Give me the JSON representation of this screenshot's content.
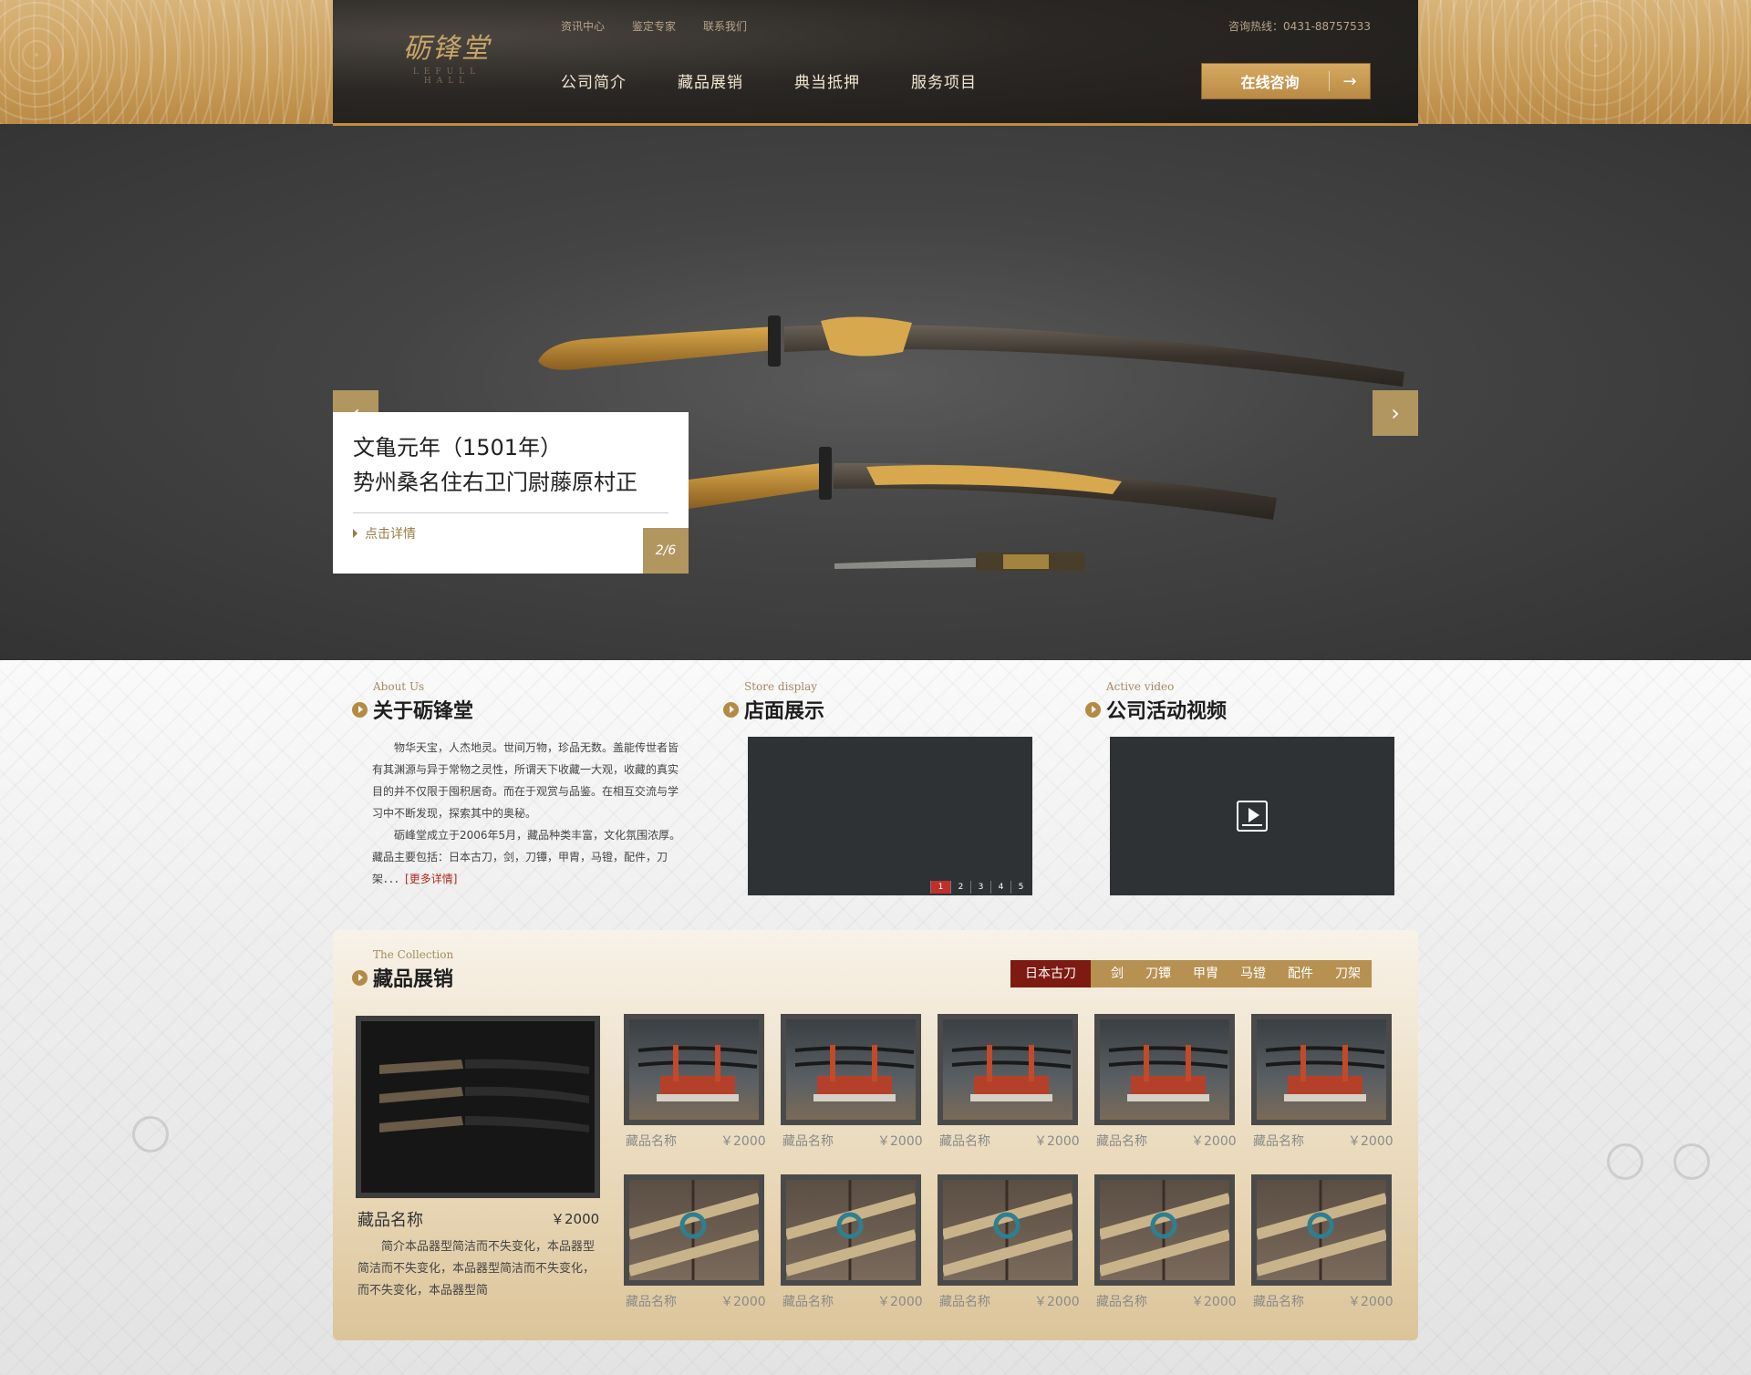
{
  "header": {
    "logo_cn": "砺锋堂",
    "logo_en": "LEFULL HALL",
    "top_links": [
      "资讯中心",
      "鉴定专家",
      "联系我们"
    ],
    "hotline": "咨询热线：0431-88757533",
    "nav": [
      "公司简介",
      "藏品展销",
      "典当抵押",
      "服务项目"
    ],
    "consult_label": "在线咨询",
    "consult_arrow": "→"
  },
  "hero": {
    "caption_line1": "文亀元年（1501年）",
    "caption_line2": "势州桑名住右卫门尉藤原村正",
    "more_label": "点击详情",
    "page_indicator": "2/6",
    "prev_icon": "‹",
    "next_icon": "›"
  },
  "about": {
    "en": "About Us",
    "title": "关于砺锋堂",
    "para1": "物华天宝，人杰地灵。世间万物，珍品无数。盖能传世者皆有其渊源与异于常物之灵性，所谓天下收藏一大观，收藏的真实目的并不仅限于囤积居奇。而在于观赏与品鉴。在相互交流与学习中不断发现，探索其中的奥秘。",
    "para2": "砺峰堂成立于2006年5月，藏品种类丰富，文化氛围浓厚。藏品主要包括：日本古刀，剑，刀镡，甲胄，马镫，配件，刀架．．．",
    "more_label": "[更多详情]"
  },
  "store": {
    "en": "Store display",
    "title": "店面展示",
    "pages": [
      "1",
      "2",
      "3",
      "4",
      "5"
    ],
    "active_page": "1"
  },
  "video": {
    "en": "Active video",
    "title": "公司活动视频"
  },
  "collection": {
    "en": "The Collection",
    "title": "藏品展销",
    "tabs": [
      "日本古刀",
      "剑",
      "刀镡",
      "甲胄",
      "马镫",
      "配件",
      "刀架"
    ],
    "active_tab": "日本古刀",
    "featured": {
      "name": "藏品名称",
      "price": "￥2000",
      "desc": "简介本品器型简洁而不失变化，本品器型简洁而不失变化，本品器型简洁而不失变化，而不失变化，本品器型简"
    },
    "items": [
      {
        "name": "藏品名称",
        "price": "￥2000"
      },
      {
        "name": "藏品名称",
        "price": "￥2000"
      },
      {
        "name": "藏品名称",
        "price": "￥2000"
      },
      {
        "name": "藏品名称",
        "price": "￥2000"
      },
      {
        "name": "藏品名称",
        "price": "￥2000"
      },
      {
        "name": "藏品名称",
        "price": "￥2000"
      },
      {
        "name": "藏品名称",
        "price": "￥2000"
      },
      {
        "name": "藏品名称",
        "price": "￥2000"
      },
      {
        "name": "藏品名称",
        "price": "￥2000"
      },
      {
        "name": "藏品名称",
        "price": "￥2000"
      }
    ]
  }
}
